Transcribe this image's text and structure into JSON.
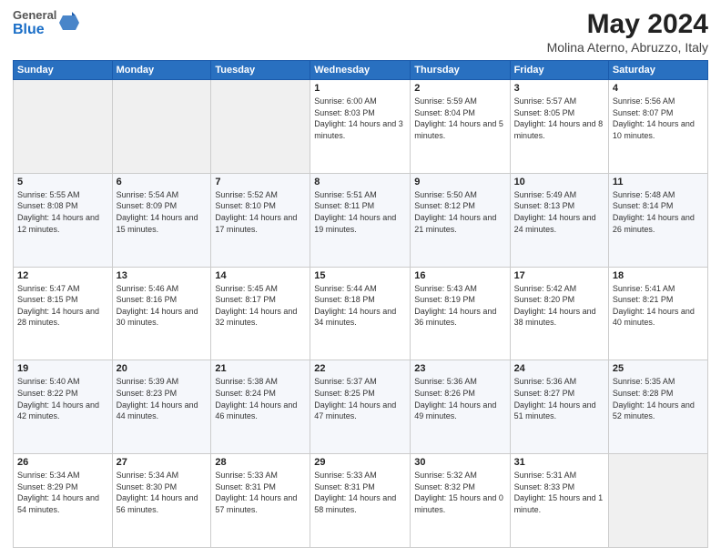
{
  "header": {
    "logo_general": "General",
    "logo_blue": "Blue",
    "month": "May 2024",
    "location": "Molina Aterno, Abruzzo, Italy"
  },
  "weekdays": [
    "Sunday",
    "Monday",
    "Tuesday",
    "Wednesday",
    "Thursday",
    "Friday",
    "Saturday"
  ],
  "weeks": [
    [
      {
        "day": "",
        "sunrise": "",
        "sunset": "",
        "daylight": ""
      },
      {
        "day": "",
        "sunrise": "",
        "sunset": "",
        "daylight": ""
      },
      {
        "day": "",
        "sunrise": "",
        "sunset": "",
        "daylight": ""
      },
      {
        "day": "1",
        "sunrise": "Sunrise: 6:00 AM",
        "sunset": "Sunset: 8:03 PM",
        "daylight": "Daylight: 14 hours and 3 minutes."
      },
      {
        "day": "2",
        "sunrise": "Sunrise: 5:59 AM",
        "sunset": "Sunset: 8:04 PM",
        "daylight": "Daylight: 14 hours and 5 minutes."
      },
      {
        "day": "3",
        "sunrise": "Sunrise: 5:57 AM",
        "sunset": "Sunset: 8:05 PM",
        "daylight": "Daylight: 14 hours and 8 minutes."
      },
      {
        "day": "4",
        "sunrise": "Sunrise: 5:56 AM",
        "sunset": "Sunset: 8:07 PM",
        "daylight": "Daylight: 14 hours and 10 minutes."
      }
    ],
    [
      {
        "day": "5",
        "sunrise": "Sunrise: 5:55 AM",
        "sunset": "Sunset: 8:08 PM",
        "daylight": "Daylight: 14 hours and 12 minutes."
      },
      {
        "day": "6",
        "sunrise": "Sunrise: 5:54 AM",
        "sunset": "Sunset: 8:09 PM",
        "daylight": "Daylight: 14 hours and 15 minutes."
      },
      {
        "day": "7",
        "sunrise": "Sunrise: 5:52 AM",
        "sunset": "Sunset: 8:10 PM",
        "daylight": "Daylight: 14 hours and 17 minutes."
      },
      {
        "day": "8",
        "sunrise": "Sunrise: 5:51 AM",
        "sunset": "Sunset: 8:11 PM",
        "daylight": "Daylight: 14 hours and 19 minutes."
      },
      {
        "day": "9",
        "sunrise": "Sunrise: 5:50 AM",
        "sunset": "Sunset: 8:12 PM",
        "daylight": "Daylight: 14 hours and 21 minutes."
      },
      {
        "day": "10",
        "sunrise": "Sunrise: 5:49 AM",
        "sunset": "Sunset: 8:13 PM",
        "daylight": "Daylight: 14 hours and 24 minutes."
      },
      {
        "day": "11",
        "sunrise": "Sunrise: 5:48 AM",
        "sunset": "Sunset: 8:14 PM",
        "daylight": "Daylight: 14 hours and 26 minutes."
      }
    ],
    [
      {
        "day": "12",
        "sunrise": "Sunrise: 5:47 AM",
        "sunset": "Sunset: 8:15 PM",
        "daylight": "Daylight: 14 hours and 28 minutes."
      },
      {
        "day": "13",
        "sunrise": "Sunrise: 5:46 AM",
        "sunset": "Sunset: 8:16 PM",
        "daylight": "Daylight: 14 hours and 30 minutes."
      },
      {
        "day": "14",
        "sunrise": "Sunrise: 5:45 AM",
        "sunset": "Sunset: 8:17 PM",
        "daylight": "Daylight: 14 hours and 32 minutes."
      },
      {
        "day": "15",
        "sunrise": "Sunrise: 5:44 AM",
        "sunset": "Sunset: 8:18 PM",
        "daylight": "Daylight: 14 hours and 34 minutes."
      },
      {
        "day": "16",
        "sunrise": "Sunrise: 5:43 AM",
        "sunset": "Sunset: 8:19 PM",
        "daylight": "Daylight: 14 hours and 36 minutes."
      },
      {
        "day": "17",
        "sunrise": "Sunrise: 5:42 AM",
        "sunset": "Sunset: 8:20 PM",
        "daylight": "Daylight: 14 hours and 38 minutes."
      },
      {
        "day": "18",
        "sunrise": "Sunrise: 5:41 AM",
        "sunset": "Sunset: 8:21 PM",
        "daylight": "Daylight: 14 hours and 40 minutes."
      }
    ],
    [
      {
        "day": "19",
        "sunrise": "Sunrise: 5:40 AM",
        "sunset": "Sunset: 8:22 PM",
        "daylight": "Daylight: 14 hours and 42 minutes."
      },
      {
        "day": "20",
        "sunrise": "Sunrise: 5:39 AM",
        "sunset": "Sunset: 8:23 PM",
        "daylight": "Daylight: 14 hours and 44 minutes."
      },
      {
        "day": "21",
        "sunrise": "Sunrise: 5:38 AM",
        "sunset": "Sunset: 8:24 PM",
        "daylight": "Daylight: 14 hours and 46 minutes."
      },
      {
        "day": "22",
        "sunrise": "Sunrise: 5:37 AM",
        "sunset": "Sunset: 8:25 PM",
        "daylight": "Daylight: 14 hours and 47 minutes."
      },
      {
        "day": "23",
        "sunrise": "Sunrise: 5:36 AM",
        "sunset": "Sunset: 8:26 PM",
        "daylight": "Daylight: 14 hours and 49 minutes."
      },
      {
        "day": "24",
        "sunrise": "Sunrise: 5:36 AM",
        "sunset": "Sunset: 8:27 PM",
        "daylight": "Daylight: 14 hours and 51 minutes."
      },
      {
        "day": "25",
        "sunrise": "Sunrise: 5:35 AM",
        "sunset": "Sunset: 8:28 PM",
        "daylight": "Daylight: 14 hours and 52 minutes."
      }
    ],
    [
      {
        "day": "26",
        "sunrise": "Sunrise: 5:34 AM",
        "sunset": "Sunset: 8:29 PM",
        "daylight": "Daylight: 14 hours and 54 minutes."
      },
      {
        "day": "27",
        "sunrise": "Sunrise: 5:34 AM",
        "sunset": "Sunset: 8:30 PM",
        "daylight": "Daylight: 14 hours and 56 minutes."
      },
      {
        "day": "28",
        "sunrise": "Sunrise: 5:33 AM",
        "sunset": "Sunset: 8:31 PM",
        "daylight": "Daylight: 14 hours and 57 minutes."
      },
      {
        "day": "29",
        "sunrise": "Sunrise: 5:33 AM",
        "sunset": "Sunset: 8:31 PM",
        "daylight": "Daylight: 14 hours and 58 minutes."
      },
      {
        "day": "30",
        "sunrise": "Sunrise: 5:32 AM",
        "sunset": "Sunset: 8:32 PM",
        "daylight": "Daylight: 15 hours and 0 minutes."
      },
      {
        "day": "31",
        "sunrise": "Sunrise: 5:31 AM",
        "sunset": "Sunset: 8:33 PM",
        "daylight": "Daylight: 15 hours and 1 minute."
      },
      {
        "day": "",
        "sunrise": "",
        "sunset": "",
        "daylight": ""
      }
    ]
  ]
}
